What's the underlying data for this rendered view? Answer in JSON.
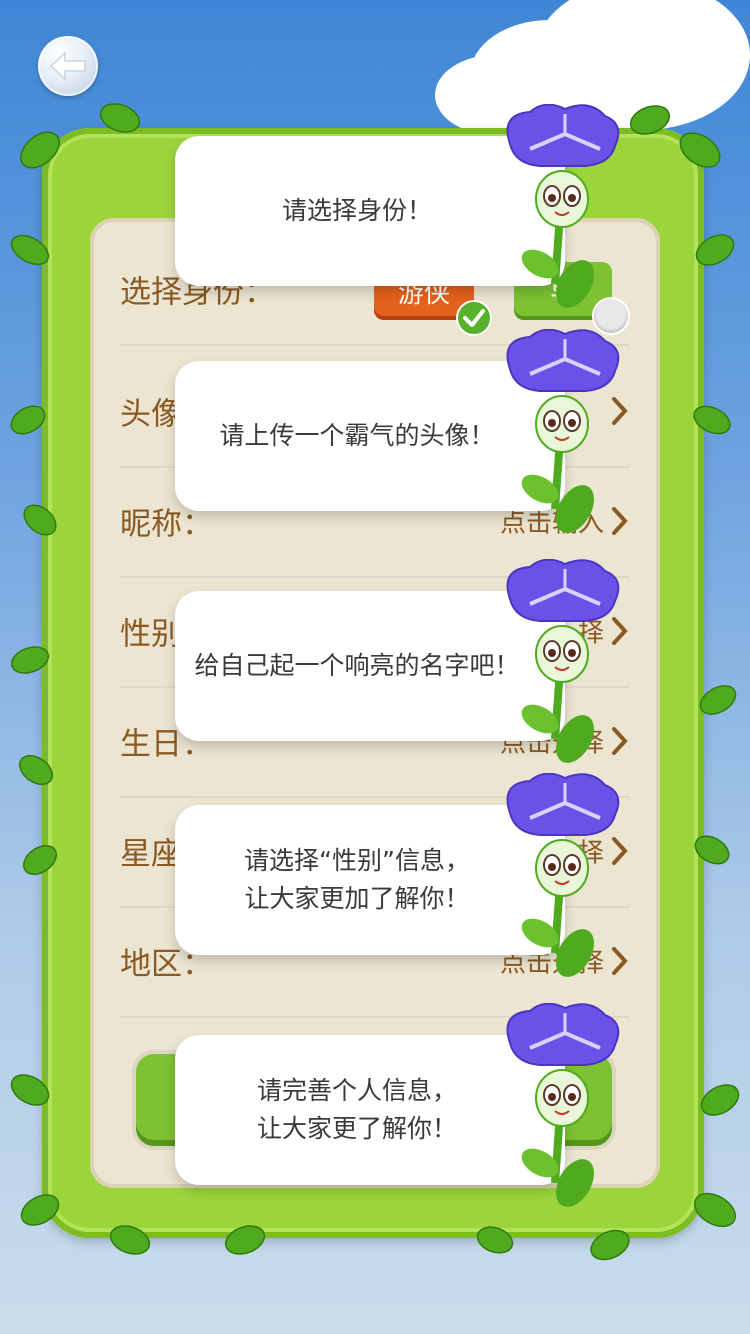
{
  "back_button": {
    "icon": "back-arrow-icon"
  },
  "form": {
    "identity_label": "选择身份：",
    "identity_options": [
      "游侠",
      "导"
    ],
    "avatar_label": "头像",
    "nickname_label": "昵称：",
    "nickname_value": "点击输入",
    "gender_label": "性别",
    "gender_value": "择",
    "birthday_label": "生日：",
    "birthday_value": "点击选择",
    "zodiac_label": "星座",
    "zodiac_value": "择",
    "region_label": "地区：",
    "region_value": "点击选择"
  },
  "tips": [
    {
      "text": "请选择身份！"
    },
    {
      "text": "请上传一个霸气的头像！"
    },
    {
      "text": "给自己起一个响亮的名字吧！"
    },
    {
      "text": "请选择“性别”信息，\n让大家更加了解你！"
    },
    {
      "text": "请完善个人信息，\n让大家更了解你！"
    }
  ],
  "colors": {
    "frame_green": "#9cd43c",
    "panel_beige": "#ece5d2",
    "label_brown": "#8a5a22",
    "orange_button": "#e4621d",
    "green_button": "#7cc233",
    "flower_purple": "#6a52e8"
  }
}
